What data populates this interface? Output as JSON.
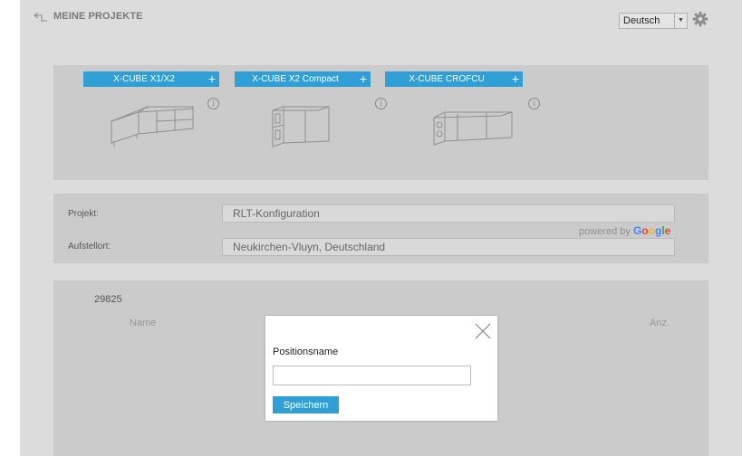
{
  "header": {
    "back_label": "MEINE PROJEKTE",
    "language": "Deutsch"
  },
  "products": [
    {
      "name": "X-CUBE X1/X2",
      "plus": "+",
      "info": "i"
    },
    {
      "name": "X-CUBE X2 Compact",
      "plus": "+",
      "info": "i"
    },
    {
      "name": "X-CUBE CROFCU",
      "plus": "+",
      "info": "i"
    }
  ],
  "project": {
    "project_label": "Projekt:",
    "project_value": "RLT-Konfiguration",
    "location_label": "Aufstellort:",
    "location_value": "Neukirchen-Vluyn, Deutschland",
    "powered_by": "powered by",
    "google": "Google"
  },
  "positions": {
    "number": "29825",
    "col_name": "Name",
    "col_anz": "Anz."
  },
  "modal": {
    "label": "Positionsname",
    "input_value": "",
    "save_label": "Speichern"
  },
  "colors": {
    "accent": "#2f9fd6",
    "overlay_bg": "#dcdcdc",
    "panel_bg": "#cbcbcb",
    "google_colors": [
      "#4285f4",
      "#ea4335",
      "#fbbc05",
      "#4285f4",
      "#34a853",
      "#ea4335"
    ]
  }
}
